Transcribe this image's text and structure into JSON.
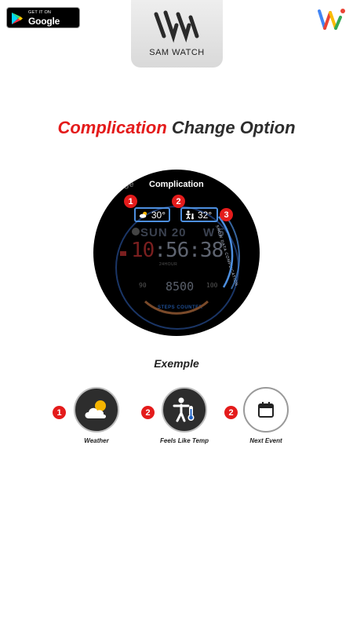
{
  "store_badge": {
    "small": "GET IT ON",
    "big": "Google Play"
  },
  "brand": {
    "name": "SAM WATCH"
  },
  "title": {
    "highlight": "Complication",
    "rest": "Change Option"
  },
  "watch": {
    "header_left": "nage",
    "header": "Complication",
    "complications": [
      {
        "number": "1",
        "value": "30°",
        "icon": "weather-icon"
      },
      {
        "number": "2",
        "value": "32°",
        "icon": "feels-like-icon"
      },
      {
        "number": "3"
      }
    ],
    "day": "SUN 20",
    "day_right": "W 5",
    "time_hours": "10",
    "time_rest": ":56:38",
    "format": "24HOUR",
    "steps": "8500",
    "steps_label": "STEPS COUNTER",
    "left_value": "90",
    "right_value": "100",
    "arc_text": "SHOW DATA COMPLICATION"
  },
  "examples_title": "Exemple",
  "examples": [
    {
      "number": "1",
      "label": "Weather",
      "icon": "weather-icon",
      "style": "dark"
    },
    {
      "number": "2",
      "label": "Feels Like Temp",
      "icon": "feels-like-temp-icon",
      "style": "dark"
    },
    {
      "number": "2",
      "label": "Next Event",
      "icon": "calendar-icon",
      "style": "light"
    }
  ],
  "colors": {
    "accent_red": "#e41b1b",
    "watch_blue": "#4d8fdf"
  }
}
